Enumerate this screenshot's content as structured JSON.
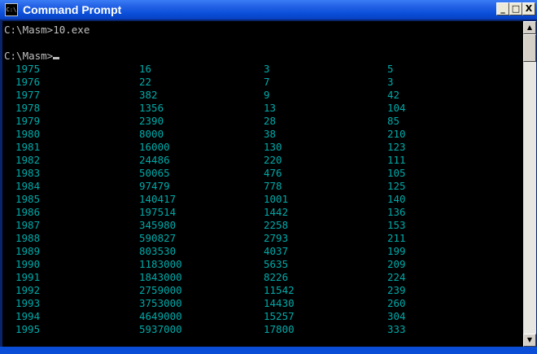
{
  "window": {
    "title": "Command Prompt",
    "icon_text": "C:\\",
    "buttons": {
      "minimize": "_",
      "maximize": "□",
      "close": "X"
    }
  },
  "console": {
    "line1": "C:\\Masm>10.exe",
    "line2": "C:\\Masm>",
    "rows": [
      [
        "1975",
        "16",
        "3",
        "5"
      ],
      [
        "1976",
        "22",
        "7",
        "3"
      ],
      [
        "1977",
        "382",
        "9",
        "42"
      ],
      [
        "1978",
        "1356",
        "13",
        "104"
      ],
      [
        "1979",
        "2390",
        "28",
        "85"
      ],
      [
        "1980",
        "8000",
        "38",
        "210"
      ],
      [
        "1981",
        "16000",
        "130",
        "123"
      ],
      [
        "1982",
        "24486",
        "220",
        "111"
      ],
      [
        "1983",
        "50065",
        "476",
        "105"
      ],
      [
        "1984",
        "97479",
        "778",
        "125"
      ],
      [
        "1985",
        "140417",
        "1001",
        "140"
      ],
      [
        "1986",
        "197514",
        "1442",
        "136"
      ],
      [
        "1987",
        "345980",
        "2258",
        "153"
      ],
      [
        "1988",
        "590827",
        "2793",
        "211"
      ],
      [
        "1989",
        "803530",
        "4037",
        "199"
      ],
      [
        "1990",
        "1183000",
        "5635",
        "209"
      ],
      [
        "1991",
        "1843000",
        "8226",
        "224"
      ],
      [
        "1992",
        "2759000",
        "11542",
        "239"
      ],
      [
        "1993",
        "3753000",
        "14430",
        "260"
      ],
      [
        "1994",
        "4649000",
        "15257",
        "304"
      ],
      [
        "1995",
        "5937000",
        "17800",
        "333"
      ]
    ]
  },
  "colors": {
    "titlebar": "#0a4ed8",
    "console_bg": "#000000",
    "prompt_text": "#c0c0c0",
    "data_text": "#00aaaa"
  }
}
